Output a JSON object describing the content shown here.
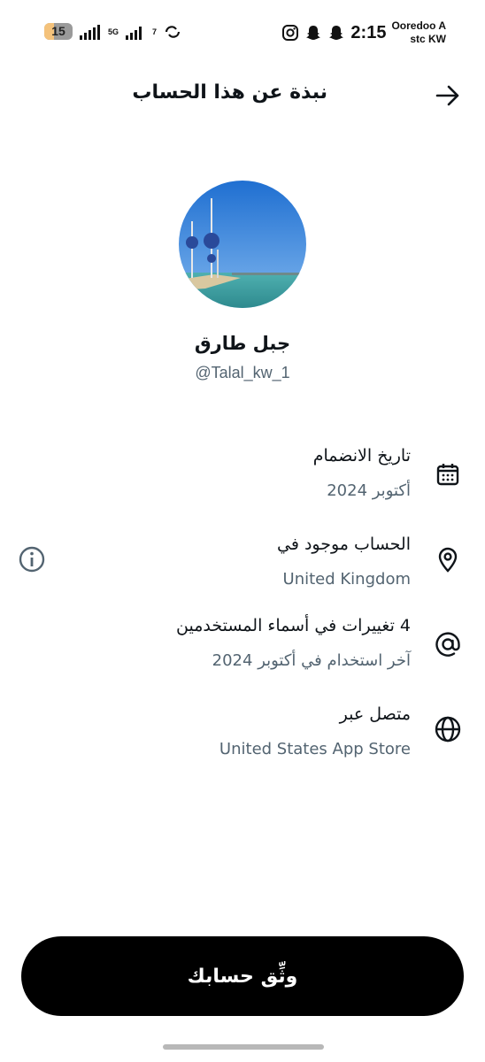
{
  "status_bar": {
    "battery_level": "15",
    "network": "5G",
    "signal_index": "7",
    "time": "2:15",
    "carrier_1": "Ooredoo A",
    "carrier_2": "stc KW",
    "icons": [
      "instagram-icon",
      "snapchat-icon",
      "snapchat-icon"
    ]
  },
  "header": {
    "title": "نبذة عن هذا الحساب",
    "back_icon": "arrow-right-icon"
  },
  "profile": {
    "display_name": "جبل طارق",
    "handle": "@Talal_kw_1"
  },
  "details": [
    {
      "icon": "calendar-icon",
      "label": "تاريخ الانضمام",
      "value": "أكتوبر 2024"
    },
    {
      "icon": "location-pin-icon",
      "label": "الحساب موجود في",
      "value": "United Kingdom"
    },
    {
      "icon": "at-sign-icon",
      "label": "4 تغييرات في أسماء المستخدمين",
      "value": "آخر استخدام في أكتوبر 2024"
    },
    {
      "icon": "globe-icon",
      "label": "متصل عبر",
      "value": "United States App Store"
    }
  ],
  "actions": {
    "verify_label": "وثِّق حسابك"
  },
  "colors": {
    "primary_text": "#0f1419",
    "secondary_text": "#536471",
    "button_bg": "#000000"
  }
}
